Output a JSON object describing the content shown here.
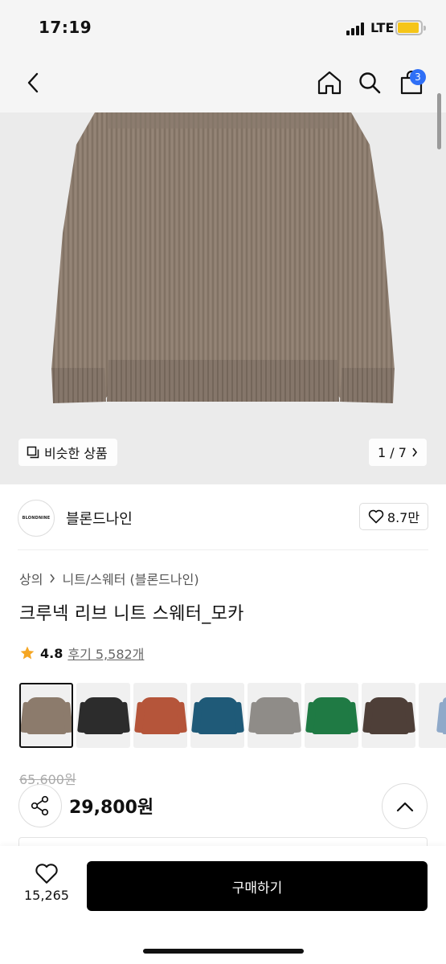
{
  "status_bar": {
    "time": "17:19",
    "network": "LTE"
  },
  "header": {
    "cart_count": "3"
  },
  "hero": {
    "similar_label": "비슷한 상품",
    "page_indicator": "1 / 7"
  },
  "brand": {
    "logo_text": "BLONDNINE",
    "name": "블론드나인",
    "likes": "8.7만"
  },
  "breadcrumb": [
    "상의",
    "니트/스웨터 (블론드나인)"
  ],
  "product": {
    "title": "크루넥 리브 니트 스웨터_모카",
    "rating": "4.8",
    "review_text": "후기 5,582개",
    "original_price": "65,600원",
    "sale_price": "29,800원"
  },
  "swatch_colors": [
    "#8c7b6c",
    "#2c2c2c",
    "#b5553a",
    "#1f5a78",
    "#8f8c88",
    "#1f7a44",
    "#4e3f38",
    "#8fa9c9"
  ],
  "bottom_bar": {
    "wish_count": "15,265",
    "buy_label": "구매하기"
  }
}
